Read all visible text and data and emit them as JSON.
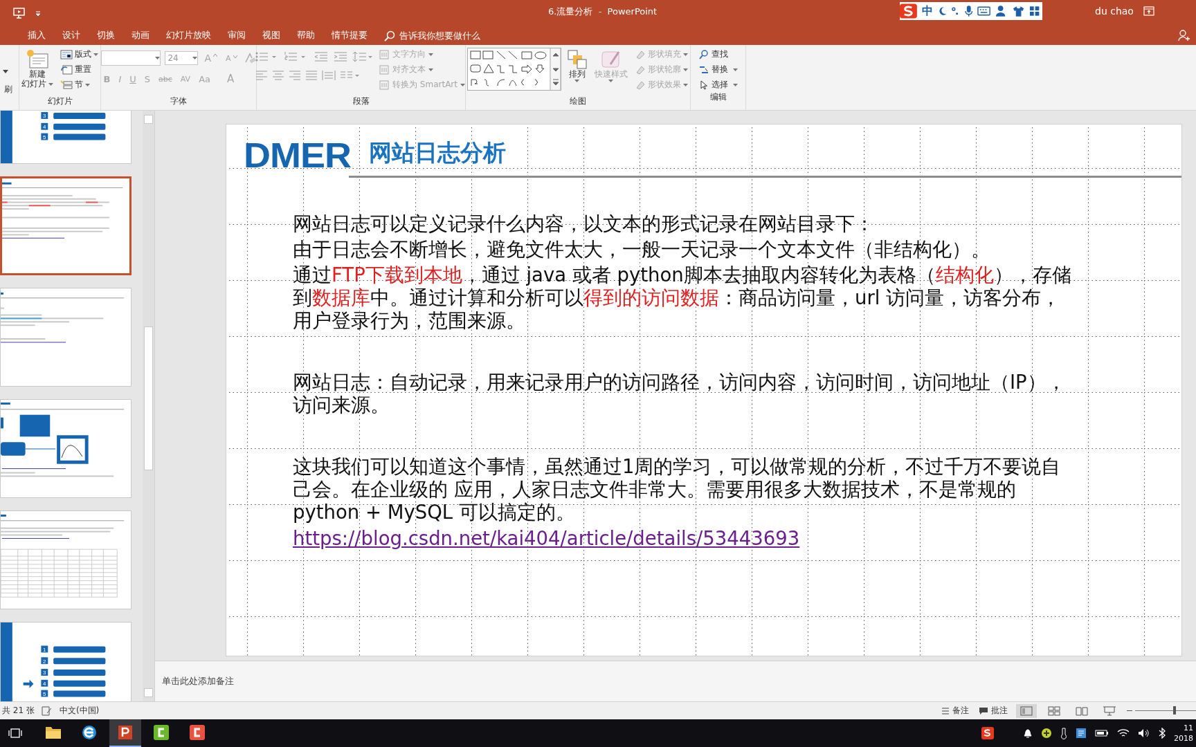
{
  "title_bar": {
    "title": "6.流量分析  -  PowerPoint",
    "ime_label": "中",
    "user": "du chao"
  },
  "ribbon_tabs": [
    {
      "label": "插入",
      "selected": false
    },
    {
      "label": "设计",
      "selected": false
    },
    {
      "label": "切换",
      "selected": false
    },
    {
      "label": "动画",
      "selected": false
    },
    {
      "label": "幻灯片放映",
      "selected": false
    },
    {
      "label": "审阅",
      "selected": false
    },
    {
      "label": "视图",
      "selected": false
    },
    {
      "label": "帮助",
      "selected": false
    },
    {
      "label": "情节提要",
      "selected": false
    }
  ],
  "tell_me": {
    "placeholder": "告诉我你想要做什么"
  },
  "ribbon": {
    "clipboard_fragment": "刷",
    "slides": {
      "label": "幻灯片",
      "new_slide": [
        "新建",
        "幻灯片"
      ],
      "layout": "版式",
      "reset": "重置",
      "section": "节"
    },
    "font": {
      "label": "字体",
      "size": "24",
      "grow": "A",
      "shrink": "A",
      "format_buttons": [
        {
          "label": "B",
          "disabled": true
        },
        {
          "label": "I",
          "disabled": true
        },
        {
          "label": "U",
          "disabled": true
        },
        {
          "label": "S",
          "disabled": true
        },
        {
          "label": "abc",
          "disabled": true
        },
        {
          "label": "AV",
          "disabled": true
        },
        {
          "label": "Aa",
          "disabled": true
        },
        {
          "label": "A",
          "disabled": true
        }
      ]
    },
    "paragraph": {
      "label": "段落",
      "commands": [
        {
          "label": "文字方向",
          "disabled": true
        },
        {
          "label": "对齐文本",
          "disabled": true
        },
        {
          "label": "转换为 SmartArt",
          "disabled": true
        }
      ]
    },
    "drawing": {
      "label": "绘图",
      "arrange": "排列",
      "quick_styles": {
        "label": "快速样式",
        "disabled": true
      },
      "commands": [
        {
          "label": "形状填充",
          "disabled": true
        },
        {
          "label": "形状轮廓",
          "disabled": true
        },
        {
          "label": "形状效果",
          "disabled": true
        }
      ]
    },
    "editing": {
      "label": "编辑",
      "commands": [
        {
          "label": "查找",
          "kind": "find"
        },
        {
          "label": "替换",
          "kind": "replace"
        },
        {
          "label": "选择",
          "kind": "select"
        }
      ]
    }
  },
  "thumbnails": [
    {
      "kind": "agenda",
      "selected": false,
      "items": [
        "3",
        "4",
        "5"
      ]
    },
    {
      "kind": "text",
      "selected": true
    },
    {
      "kind": "code",
      "selected": false
    },
    {
      "kind": "diagram",
      "selected": false
    },
    {
      "kind": "table",
      "selected": false
    },
    {
      "kind": "agenda",
      "selected": false,
      "items": [
        "1",
        "2",
        "3",
        "4",
        "5"
      ]
    }
  ],
  "slide": {
    "logo": "DMER",
    "title": "网站日志分析",
    "sections": [
      {
        "paragraphs": [
          {
            "segments": [
              {
                "text": "网站日志可以定义记录什么内容，以文本的形式记录在网站目录下：",
                "emphasis": false
              }
            ]
          },
          {
            "segments": [
              {
                "text": "由于日志会不断增长，避免文件太大，一般一天记录一个文本文件（非结构化）。",
                "emphasis": false
              }
            ]
          },
          {
            "segments": [
              {
                "text": "通过",
                "emphasis": false
              },
              {
                "text": "FTP下载到本地",
                "emphasis": true
              },
              {
                "text": "，通过 java 或者 python脚本去抽取内容转化为表格（",
                "emphasis": false
              },
              {
                "text": "结构化",
                "emphasis": true
              },
              {
                "text": "），存储到",
                "emphasis": false
              },
              {
                "text": "数据库",
                "emphasis": true
              },
              {
                "text": "中。通过计算和分析可以",
                "emphasis": false
              },
              {
                "text": "得到的访问数据",
                "emphasis": true
              },
              {
                "text": "：商品访问量，url 访问量，访客分布，用户登录行为，范围来源。",
                "emphasis": false
              }
            ]
          }
        ]
      },
      {
        "paragraphs": [
          {
            "segments": [
              {
                "text": "网站日志：自动记录，用来记录用户的访问路径，访问内容，访问时间，访问地址（IP），访问来源。",
                "emphasis": false
              }
            ]
          }
        ]
      },
      {
        "paragraphs": [
          {
            "segments": [
              {
                "text": "这块我们可以知道这个事情，虽然通过1周的学习，可以做常规的分析，不过千万不要说自己会。在企业级的 应用，人家日志文件非常大。需要用很多大数据技术，不是常规的 python + MySQL 可以搞定的。",
                "emphasis": false
              }
            ]
          }
        ]
      }
    ],
    "link": "https://blog.csdn.net/kai404/article/details/53443693"
  },
  "notes": {
    "placeholder": "单击此处添加备注"
  },
  "status_bar": {
    "slide_count": "共 21 张",
    "language": "中文(中国)",
    "notes": "备注",
    "comments": "批注",
    "zoom": {
      "level": 0.62
    }
  },
  "taskbar": {
    "apps": [
      {
        "kind": "folder",
        "selected": false
      },
      {
        "kind": "browser",
        "selected": false
      },
      {
        "kind": "powerpoint",
        "selected": true
      },
      {
        "kind": "recorder",
        "selected": false
      },
      {
        "kind": "editor",
        "selected": false
      }
    ],
    "clock_time": "11",
    "clock_date": "2018"
  }
}
